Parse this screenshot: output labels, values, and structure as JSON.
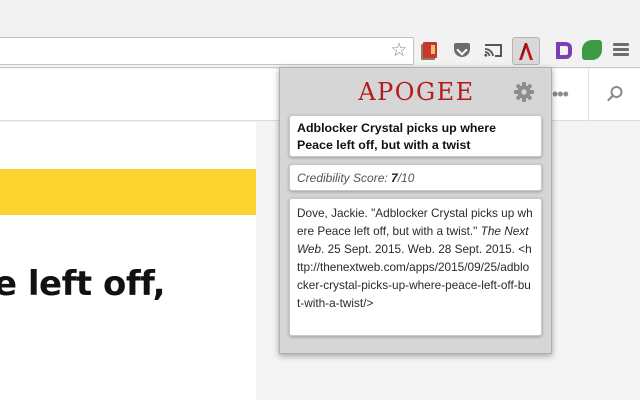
{
  "browser": {
    "star_icon": "☆",
    "extensions": [
      "red-book-icon",
      "pocket-icon",
      "cast-icon",
      "apogee-icon",
      "purple-p-icon",
      "evernote-icon"
    ],
    "menu_icon": "hamburger-menu-icon"
  },
  "page": {
    "more_icon": "•••",
    "search_icon": "search-icon",
    "headline_fragment": "e left off,",
    "accent_color": "#fdd330"
  },
  "popup": {
    "title": "APOGEE",
    "title_color": "#b31c1c",
    "settings_icon": "gear-icon",
    "article_title": "Adblocker Crystal picks up where Peace left off, but with a twist",
    "credibility_label": "Credibility Score: ",
    "credibility_score": "7",
    "credibility_max": "/10",
    "citation": {
      "authors_title": "Dove, Jackie. \"Adblocker Crystal picks up where Peace left off, but with a twist.\" ",
      "publication": "The Next Web",
      "dates": ". 25 Sept. 2015. Web. 28 Sept. 2015.",
      "url": "<http://thenextweb.com/apps/2015/09/25/adblocker-crystal-picks-up-where-peace-left-off-but-with-a-twist/>"
    }
  }
}
